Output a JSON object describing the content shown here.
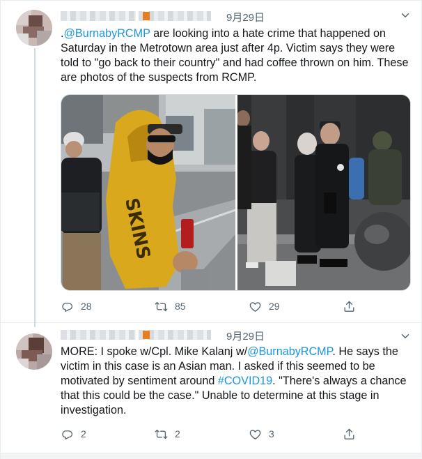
{
  "tweets": [
    {
      "date": "9月29日",
      "text_parts": [
        {
          "t": ".",
          "link": false
        },
        {
          "t": "@BurnabyRCMP",
          "link": true
        },
        {
          "t": " are looking into a hate crime that happened on Saturday in the Metrotown area just after 4p. Victim says they were told to \"go back to their country\" and had coffee thrown on him. These are photos of the suspects from RCMP.",
          "link": false
        }
      ],
      "media": [
        {
          "icon": "photo-suspect-yellow-hoodie"
        },
        {
          "icon": "photo-suspects-group"
        }
      ],
      "replies": "28",
      "retweets": "85",
      "likes": "29"
    },
    {
      "date": "9月29日",
      "text_parts": [
        {
          "t": "MORE: I spoke w/Cpl. Mike Kalanj w/",
          "link": false
        },
        {
          "t": "@BurnabyRCMP",
          "link": true
        },
        {
          "t": ". He says the victim in this case is an Asian man. I asked if this seemed to be motivated by sentiment around ",
          "link": false
        },
        {
          "t": "#COVID19",
          "link": true
        },
        {
          "t": ". \"There's always a chance that this could be the case.\" Unable to determine at this stage in investigation.",
          "link": false
        }
      ],
      "replies": "2",
      "retweets": "2",
      "likes": "3"
    }
  ],
  "colors": {
    "link": "#1b95e0",
    "text": "#14171a",
    "secondary": "#536471",
    "border": "#e6ecf0"
  },
  "icons": {
    "reply": "reply-icon",
    "retweet": "retweet-icon",
    "like": "like-icon",
    "share": "share-icon",
    "more": "chevron-down-icon"
  }
}
